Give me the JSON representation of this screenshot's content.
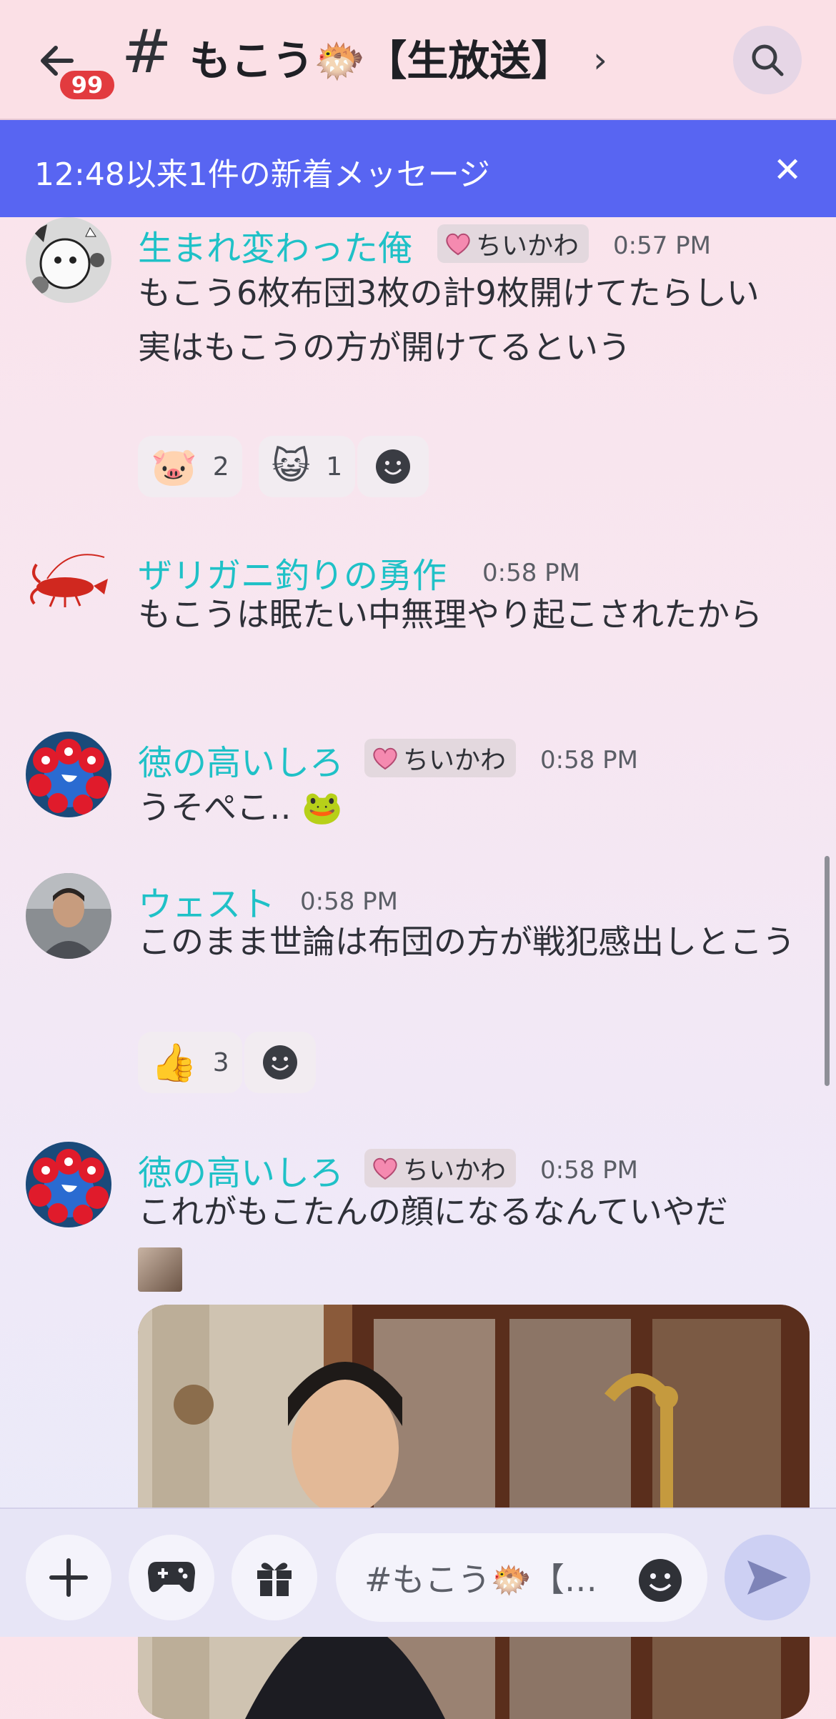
{
  "header": {
    "unread_badge": "99",
    "channel_hash": "#",
    "channel_name": "もこう🐡【生放送】",
    "chevron": "›",
    "icons": {
      "back": "arrow-left-icon",
      "search": "search-icon"
    }
  },
  "banner": {
    "text": "12:48以来1件の新着メッセージ",
    "close": "✕"
  },
  "messages": [
    {
      "username": "生まれ変わった俺",
      "role": "ちいかわ",
      "time": "0:57 PM",
      "text": "もこう6枚布団3枚の計9枚開けてたらしい\n実はもこうの方が開けてるという",
      "reactions": [
        {
          "emoji": "🐷",
          "count": "2"
        },
        {
          "emoji": "😺",
          "count": "1"
        }
      ]
    },
    {
      "username": "ザリガニ釣りの勇作",
      "time": "0:58 PM",
      "text": "もこうは眠たい中無理やり起こされたから"
    },
    {
      "username": "徳の高いしろ",
      "role": "ちいかわ",
      "time": "0:58 PM",
      "text": "うそぺこ‥",
      "inline_emoji": "🐸"
    },
    {
      "username": "ウェスト",
      "time": "0:58 PM",
      "text": "このまま世論は布団の方が戦犯感出しとこう",
      "reactions": [
        {
          "emoji": "👍",
          "count": "3"
        }
      ]
    },
    {
      "username": "徳の高いしろ",
      "role": "ちいかわ",
      "time": "0:58 PM",
      "text": "これがもこたんの顔になるなんていやだ"
    }
  ],
  "composer": {
    "placeholder": "#もこう🐡【…",
    "icons": {
      "add": "plus-icon",
      "games": "gamepad-icon",
      "gift": "gift-icon",
      "emoji": "emoji-icon",
      "send": "send-icon"
    }
  },
  "colors": {
    "banner": "#5865f2",
    "username": "#1fc1c7",
    "badge": "#e23b3f",
    "header_bg": "#fbe0e6"
  }
}
